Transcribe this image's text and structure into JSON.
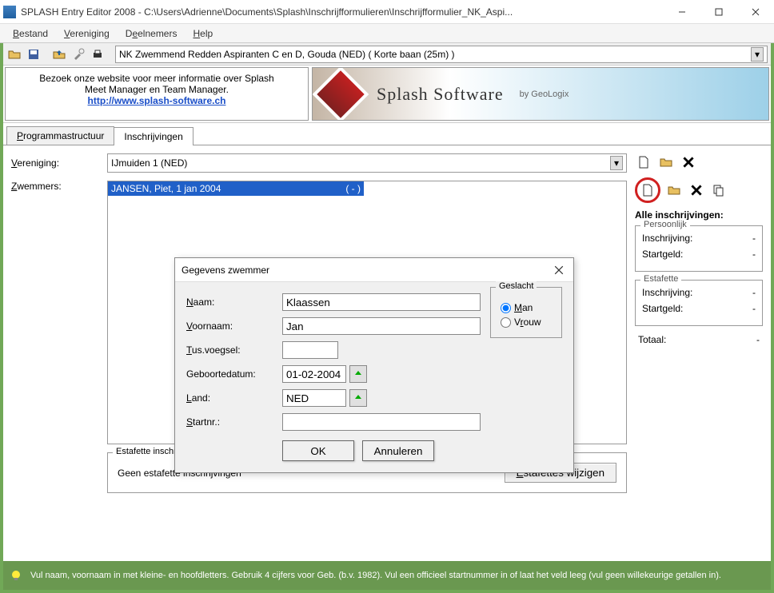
{
  "window": {
    "title": "SPLASH Entry Editor 2008 - C:\\Users\\Adrienne\\Documents\\Splash\\Inschrijfformulieren\\Inschrijfformulier_NK_Aspi..."
  },
  "menu": {
    "bestand": "Bestand",
    "vereniging": "Vereniging",
    "deelnemers": "Deelnemers",
    "help": "Help"
  },
  "toolbar": {
    "event": "NK Zwemmend Redden Aspiranten C en D,  Gouda  (NED)    ( Korte baan (25m) )"
  },
  "info": {
    "line1": "Bezoek onze website voor meer informatie over Splash",
    "line2": "Meet Manager en Team Manager.",
    "link": "http://www.splash-software.ch"
  },
  "banner": {
    "title": "Splash Software",
    "sub": "by GeoLogix"
  },
  "tabs": {
    "prog": "Programmastructuur",
    "insch": "Inschrijvingen"
  },
  "labels": {
    "vereniging": "Vereniging:",
    "zwemmers": "Zwemmers:"
  },
  "vereniging_value": "IJmuiden 1 (NED)",
  "swimmer": {
    "name": "JANSEN, Piet, 1 jan 2004",
    "count": "( - )"
  },
  "side": {
    "title": "Alle inschrijvingen:",
    "persoonlijk": "Persoonlijk",
    "inschrijving": "Inschrijving:",
    "startgeld": "Startgeld:",
    "estafette": "Estafette",
    "totaal": "Totaal:",
    "dash": "-"
  },
  "estafette": {
    "legend": "Estafette inschrijving",
    "text": "Geen estafette inschrijvingen",
    "button": "Estafettes wijzigen"
  },
  "dialog": {
    "title": "Gegevens zwemmer",
    "naam_label": "Naam:",
    "naam": "Klaassen",
    "voornaam_label": "Voornaam:",
    "voornaam": "Jan",
    "tus_label": "Tus.voegsel:",
    "tus": "",
    "geb_label": "Geboortedatum:",
    "geb": "01-02-2004",
    "land_label": "Land:",
    "land": "NED",
    "startnr_label": "Startnr.:",
    "startnr": "",
    "geslacht": "Geslacht",
    "man": "Man",
    "vrouw": "Vrouw",
    "ok": "OK",
    "annuleren": "Annuleren"
  },
  "status": "Vul naam, voornaam in met kleine- en hoofdletters. Gebruik 4 cijfers voor Geb. (b.v. 1982). Vul een officieel startnummer in of laat het veld leeg (vul geen willekeurige getallen in)."
}
